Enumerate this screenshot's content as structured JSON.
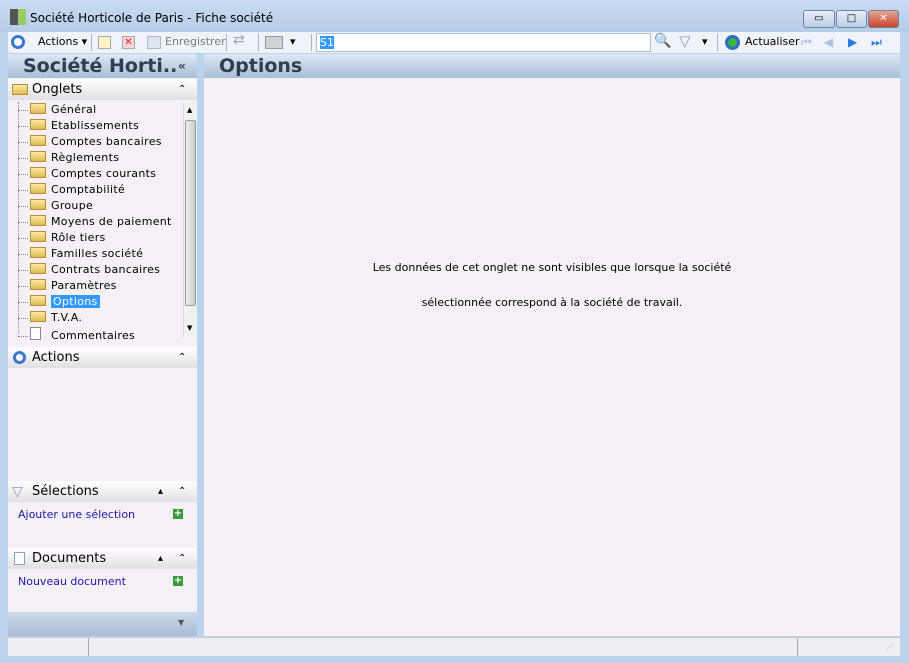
{
  "window": {
    "title": "Société Horticole de Paris -  Fiche société",
    "min": "▭",
    "max": "□",
    "close": "✕"
  },
  "toolbar": {
    "actions": "Actions",
    "save": "Enregistrer",
    "search_value": "S1",
    "refresh": "Actualiser"
  },
  "left_header": "Société Horti..",
  "collapse": "«",
  "main_header": "Options",
  "onglets": {
    "title": "Onglets",
    "items": [
      "Général",
      "Etablissements",
      "Comptes bancaires",
      "Règlements",
      "Comptes courants",
      "Comptabilité",
      "Groupe",
      "Moyens de paiement",
      "Rôle tiers",
      "Familles société",
      "Contrats bancaires",
      "Paramètres",
      "Options",
      "T.V.A.",
      "Commentaires"
    ],
    "selected": "Options"
  },
  "actions_panel": {
    "title": "Actions"
  },
  "selections": {
    "title": "Sélections",
    "link": "Ajouter une sélection"
  },
  "documents": {
    "title": "Documents",
    "link": "Nouveau document"
  },
  "message": {
    "line1": "Les données de cet onglet ne sont visibles que lorsque la société",
    "line2": "sélectionnée correspond à la société de travail."
  }
}
